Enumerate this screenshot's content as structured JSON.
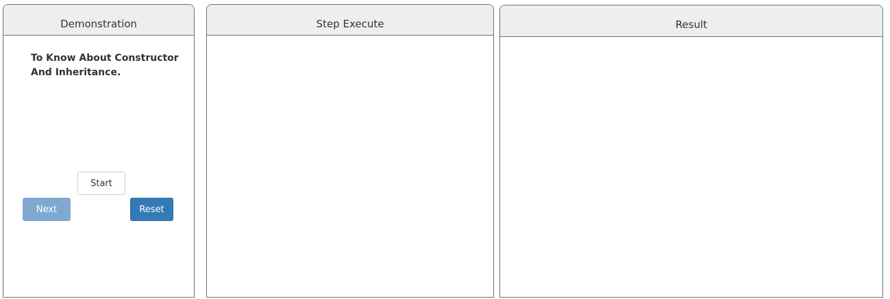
{
  "demonstration": {
    "header": "Demonstration",
    "title": "To Know About Constructor And Inheritance.",
    "buttons": {
      "start": "Start",
      "next": "Next",
      "reset": "Reset"
    }
  },
  "step_execute": {
    "header": "Step Execute"
  },
  "result": {
    "header": "Result"
  },
  "colors": {
    "header_bg": "#eeeeee",
    "border": "#6f6f6f",
    "next_disabled": "#7fa9d1",
    "primary": "#337ab7"
  }
}
